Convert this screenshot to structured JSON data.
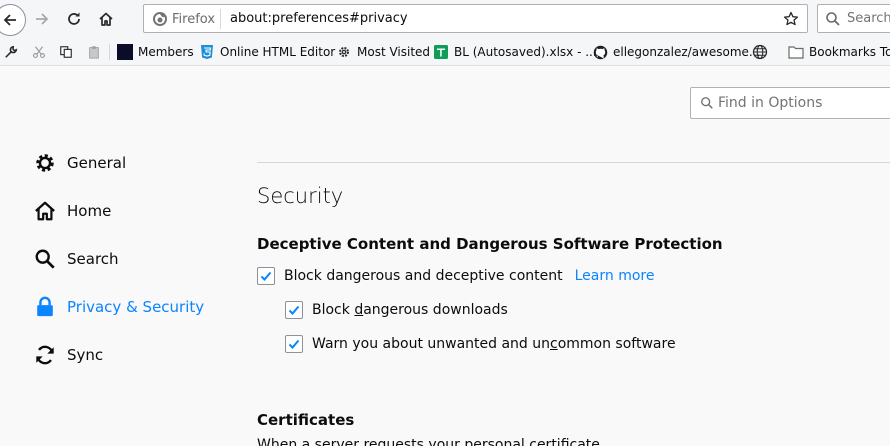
{
  "toolbar": {
    "identity_label": "Firefox",
    "url": "about:preferences#privacy",
    "search_placeholder": "Search"
  },
  "bookmarks": [
    {
      "label": "Members",
      "icon": "members-favicon"
    },
    {
      "label": "Online HTML Editor",
      "icon": "html5-favicon"
    },
    {
      "label": "Most Visited",
      "icon": "gear-favicon"
    },
    {
      "label": "BL (Autosaved).xlsx - ...",
      "icon": "sheets-favicon"
    },
    {
      "label": "ellegonzalez/awesome...",
      "icon": "github-favicon"
    },
    {
      "label": "",
      "icon": "globe-favicon"
    },
    {
      "label": "Bookmarks Toolbar",
      "icon": "folder-icon"
    }
  ],
  "find": {
    "placeholder": "Find in Options"
  },
  "categories": [
    {
      "label": "General",
      "icon": "gear-icon",
      "selected": false
    },
    {
      "label": "Home",
      "icon": "home-icon",
      "selected": false
    },
    {
      "label": "Search",
      "icon": "search-icon",
      "selected": false
    },
    {
      "label": "Privacy & Security",
      "icon": "lock-icon",
      "selected": true
    },
    {
      "label": "Sync",
      "icon": "sync-icon",
      "selected": false
    }
  ],
  "main": {
    "section_title": "Security",
    "deceptive_heading": "Deceptive Content and Dangerous Software Protection",
    "block_dangerous_label": "Block dangerous and deceptive content",
    "learn_more": "Learn more",
    "block_downloads_pre": "Block ",
    "block_downloads_key": "d",
    "block_downloads_post": "angerous downloads",
    "warn_pre": "Warn you about unwanted and un",
    "warn_key": "c",
    "warn_post": "ommon software",
    "certificates_heading": "Certificates",
    "certificates_desc": "When a server requests your personal certificate"
  },
  "colors": {
    "accent": "#0a84ff",
    "background": "#f9f9fa",
    "toolbar": "#f5f6f7"
  }
}
